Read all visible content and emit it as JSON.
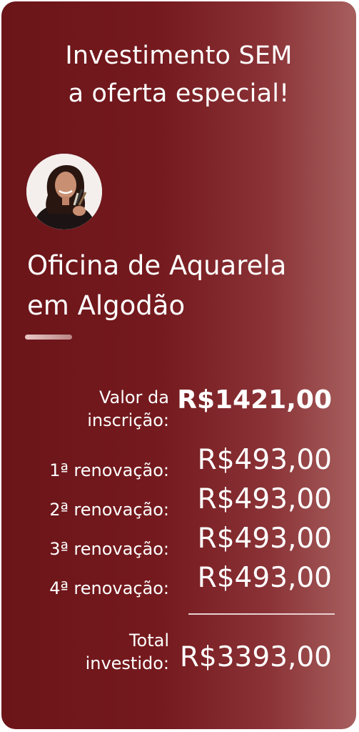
{
  "headline": {
    "line1": "Investimento SEM",
    "line2": "a oferta especial!"
  },
  "course": {
    "title_line1": "Oficina de Aquarela",
    "title_line2": "em Algodão"
  },
  "pricing": {
    "registration": {
      "label_line1": "Valor da",
      "label_line2": "inscrição:",
      "value": "R$1421,00"
    },
    "renewals": [
      {
        "label": "1ª renovação:",
        "value": "R$493,00"
      },
      {
        "label": "2ª renovação:",
        "value": "R$493,00"
      },
      {
        "label": "3ª renovação:",
        "value": "R$493,00"
      },
      {
        "label": "4ª renovação:",
        "value": "R$493,00"
      }
    ],
    "total": {
      "label_line1": "Total",
      "label_line2": "investido:",
      "value": "R$3393,00"
    }
  },
  "icons": {
    "avatar": "instructor-avatar-photo"
  },
  "colors": {
    "card_dark": "#6b1519",
    "card_light": "#a75f5e",
    "text": "#ffffff",
    "accent": "#e8c8c6"
  }
}
